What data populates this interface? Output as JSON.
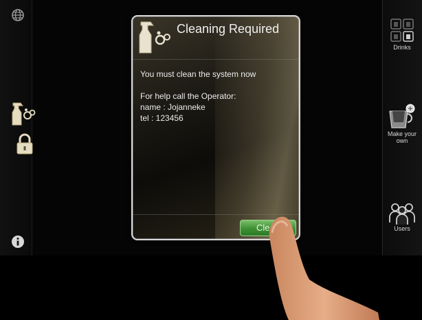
{
  "dialog": {
    "title": "Cleaning Required",
    "message": "You must clean the system now",
    "help_line": "For help call the Operator:",
    "name_line": "name : Jojanneke",
    "tel_line": "tel : 123456",
    "button_label": "Clean"
  },
  "right_nav": {
    "drinks_label": "Drinks",
    "make_your_own_label_1": "Make your",
    "make_your_own_label_2": "own",
    "users_label": "Users"
  },
  "left_nav": {
    "icons": [
      "globe-icon",
      "cleaning-icon",
      "lock-icon",
      "info-icon"
    ]
  },
  "colors": {
    "accent_gold": "#d8c89a",
    "button_green": "#3e8f34",
    "background": "#050505"
  }
}
